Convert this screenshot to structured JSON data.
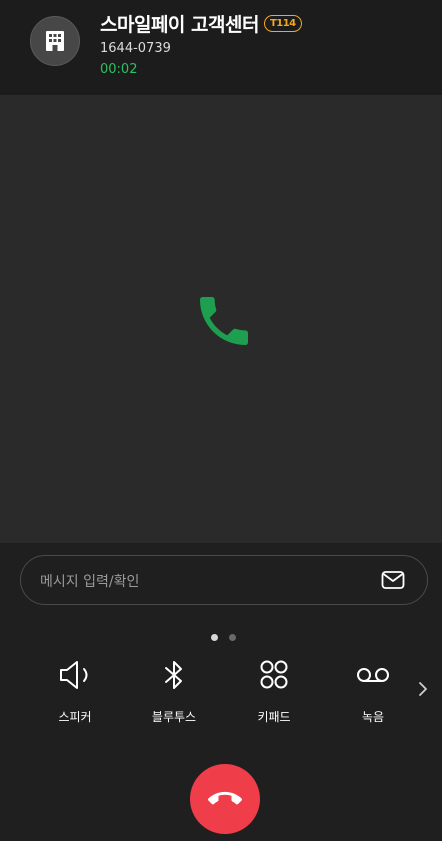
{
  "contact": {
    "name": "스마일페이 고객센터",
    "badge": "T114",
    "number": "1644-0739",
    "timer": "00:02"
  },
  "avatar_icon": "building-icon",
  "call_status_icon": "phone-icon",
  "message": {
    "placeholder": "메시지 입력/확인",
    "icon": "envelope-icon"
  },
  "pagination": {
    "current": 1,
    "total": 2
  },
  "actions": [
    {
      "label": "스피커",
      "icon": "speaker-icon"
    },
    {
      "label": "블루투스",
      "icon": "bluetooth-icon"
    },
    {
      "label": "키패드",
      "icon": "keypad-icon"
    },
    {
      "label": "녹음",
      "icon": "voicemail-record-icon"
    }
  ],
  "more_icon": "chevron-right-icon",
  "end_call_icon": "end-call-icon",
  "colors": {
    "background": "#1f1f1f",
    "call_area": "#2a2a2a",
    "timer_green": "#2fbf62",
    "call_icon_green": "#1e9e4f",
    "badge_orange": "#f5a623",
    "end_call_red": "#ef3e4a"
  }
}
